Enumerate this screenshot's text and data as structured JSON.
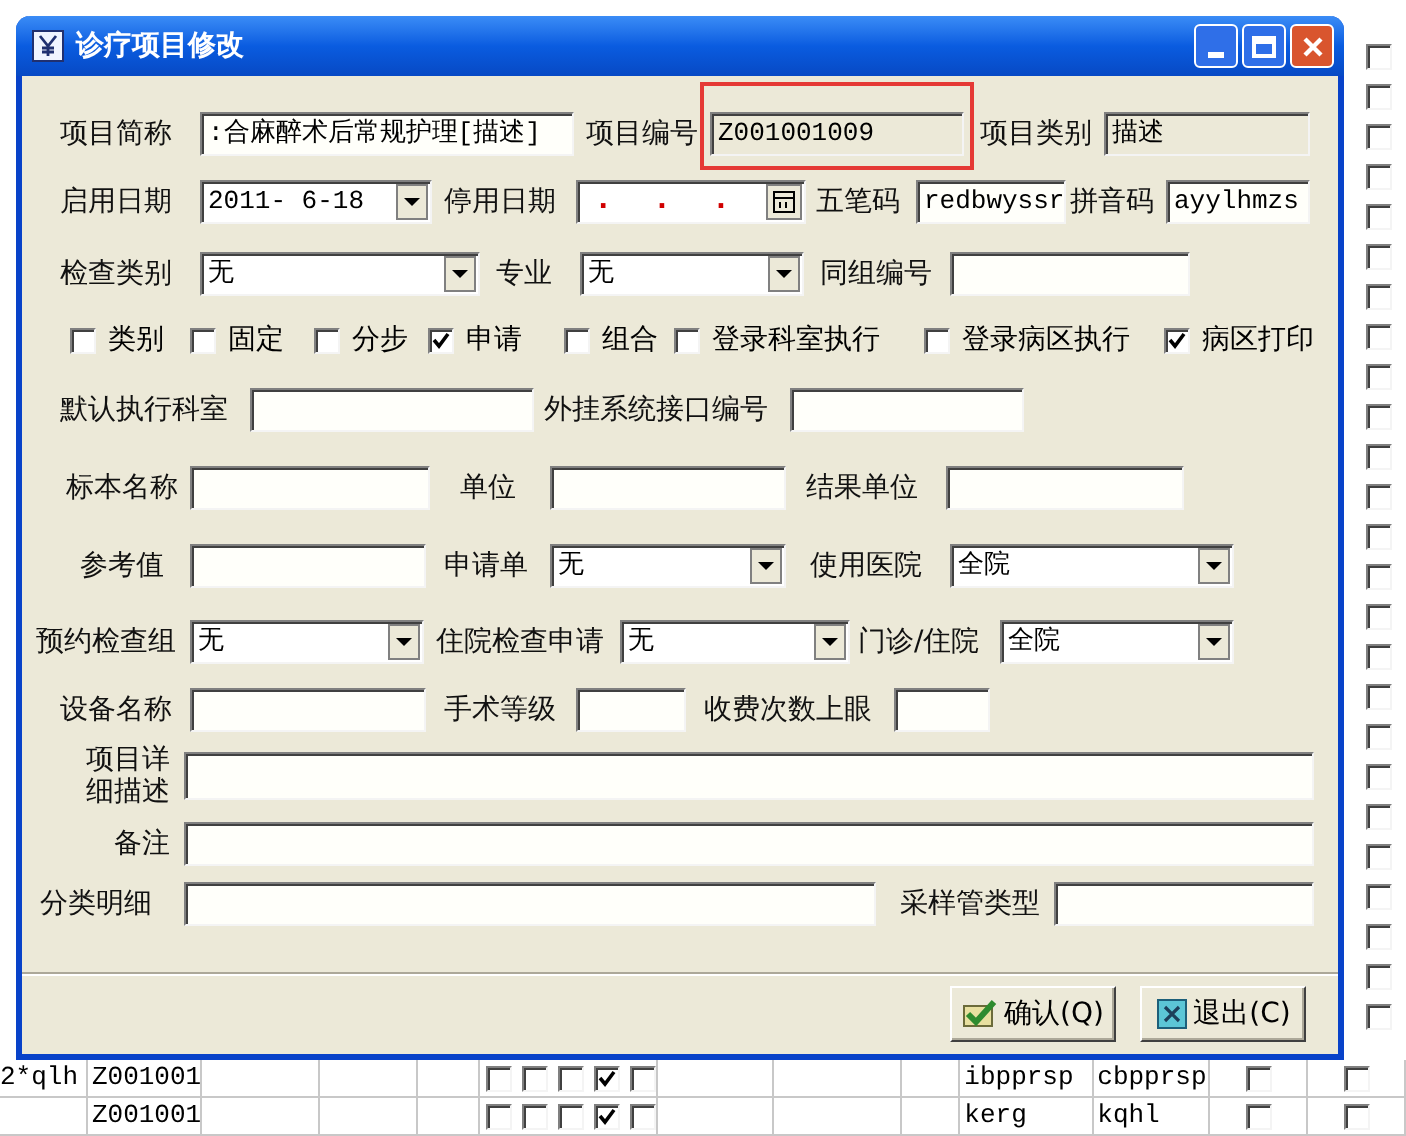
{
  "side_checks": [
    false,
    false,
    false,
    false,
    false,
    false,
    false,
    false,
    false,
    false,
    false,
    false,
    false,
    false,
    false,
    false,
    false,
    false,
    false,
    false,
    false,
    false,
    false,
    false,
    false
  ],
  "grid_rows": [
    {
      "col_1": "2*qlh",
      "col_2": "Z001001",
      "checks": [
        false,
        false,
        false,
        true,
        false
      ],
      "col_3": "ibpprsp",
      "col_4": "cbpprsp",
      "end_checks": [
        false,
        false
      ]
    },
    {
      "col_2": "Z001001",
      "checks": [
        false,
        false,
        false,
        true,
        false
      ],
      "col_3": "kerg",
      "col_4": "kqhl",
      "end_checks": [
        false,
        false
      ]
    }
  ],
  "dialog": {
    "title": "诊疗项目修改",
    "rows": [
      {
        "items": [
          {
            "kind": "label",
            "text": "项目简称"
          },
          {
            "kind": "text_field",
            "value": ":合麻醉术后常规护理[描述]"
          },
          {
            "kind": "label",
            "text": "项目编号"
          },
          {
            "kind": "text_field",
            "value": "Z001001009",
            "readonly": true,
            "highlighted": true
          },
          {
            "kind": "label",
            "text": "项目类别"
          },
          {
            "kind": "text_field",
            "value": "描述",
            "readonly": true
          }
        ]
      },
      {
        "items": [
          {
            "kind": "label",
            "text": "启用日期"
          },
          {
            "kind": "combo",
            "value": "2011- 6-18"
          },
          {
            "kind": "label",
            "text": "停用日期"
          },
          {
            "kind": "date_field",
            "value": ". . ."
          },
          {
            "kind": "label",
            "text": "五笔码"
          },
          {
            "kind": "text_field",
            "value": "redbwyssr"
          },
          {
            "kind": "label",
            "text": "拼音码"
          },
          {
            "kind": "text_field",
            "value": "ayylhmzs"
          }
        ]
      },
      {
        "items": [
          {
            "kind": "label",
            "text": "检查类别"
          },
          {
            "kind": "combo",
            "value": "无"
          },
          {
            "kind": "label",
            "text": "专业"
          },
          {
            "kind": "combo",
            "value": "无"
          },
          {
            "kind": "label",
            "text": "同组编号"
          },
          {
            "kind": "text_field"
          }
        ]
      },
      {
        "items": [
          {
            "kind": "checkbox",
            "text": "类别",
            "checked": false
          },
          {
            "kind": "checkbox",
            "text": "固定",
            "checked": false
          },
          {
            "kind": "checkbox",
            "text": "分步",
            "checked": false
          },
          {
            "kind": "checkbox",
            "text": "申请",
            "checked": true
          },
          {
            "kind": "checkbox",
            "text": "组合",
            "checked": false
          },
          {
            "kind": "checkbox",
            "text": "登录科室执行",
            "checked": false
          },
          {
            "kind": "checkbox",
            "text": "登录病区执行",
            "checked": false
          },
          {
            "kind": "checkbox",
            "text": "病区打印",
            "checked": true
          }
        ]
      },
      {
        "items": [
          {
            "kind": "label",
            "text": "默认执行科室"
          },
          {
            "kind": "text_field"
          },
          {
            "kind": "label",
            "text": "外挂系统接口编号"
          },
          {
            "kind": "text_field"
          }
        ]
      },
      {
        "items": [
          {
            "kind": "label",
            "text": "标本名称"
          },
          {
            "kind": "text_field"
          },
          {
            "kind": "label",
            "text": "单位"
          },
          {
            "kind": "text_field"
          },
          {
            "kind": "label",
            "text": "结果单位"
          },
          {
            "kind": "text_field"
          }
        ]
      },
      {
        "items": [
          {
            "kind": "label",
            "text": "参考值"
          },
          {
            "kind": "text_field"
          },
          {
            "kind": "label",
            "text": "申请单"
          },
          {
            "kind": "combo",
            "value": "无"
          },
          {
            "kind": "label",
            "text": "使用医院"
          },
          {
            "kind": "combo",
            "value": "全院"
          }
        ]
      },
      {
        "items": [
          {
            "kind": "label",
            "text": "预约检查组"
          },
          {
            "kind": "combo",
            "value": "无"
          },
          {
            "kind": "label",
            "text": "住院检查申请"
          },
          {
            "kind": "combo",
            "value": "无"
          },
          {
            "kind": "label",
            "text": "门诊/住院"
          },
          {
            "kind": "combo",
            "value": "全院"
          }
        ]
      },
      {
        "items": [
          {
            "kind": "label",
            "text": "设备名称"
          },
          {
            "kind": "text_field"
          },
          {
            "kind": "label",
            "text": "手术等级"
          },
          {
            "kind": "text_field"
          },
          {
            "kind": "label",
            "text": "收费次数上眼"
          },
          {
            "kind": "text_field"
          }
        ]
      },
      {
        "items": [
          {
            "kind": "label",
            "text": "项目详细描述"
          },
          {
            "kind": "text_field"
          }
        ]
      },
      {
        "items": [
          {
            "kind": "label",
            "text": "备注"
          },
          {
            "kind": "text_field"
          }
        ]
      },
      {
        "items": [
          {
            "kind": "label",
            "text": "分类明细"
          },
          {
            "kind": "text_field"
          },
          {
            "kind": "label",
            "text": "采样管类型"
          },
          {
            "kind": "text_field"
          }
        ]
      }
    ],
    "buttons": [
      {
        "kind": "confirm",
        "label": "确认(Q)"
      },
      {
        "kind": "exit",
        "label": "退出(C)"
      }
    ]
  }
}
